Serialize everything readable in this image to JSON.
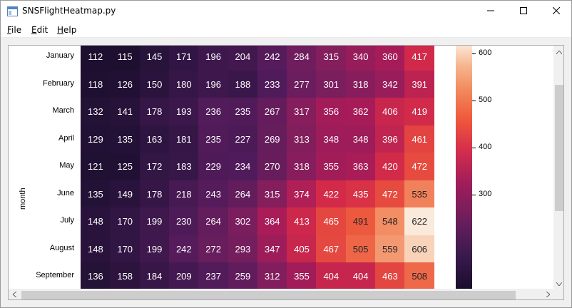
{
  "window": {
    "title": "SNSFlightHeatmap.py",
    "minimize_icon": "minimize-icon",
    "maximize_icon": "maximize-icon",
    "close_icon": "close-icon"
  },
  "menu": {
    "items": [
      {
        "label": "File",
        "mnemonic": "F",
        "rest": "ile"
      },
      {
        "label": "Edit",
        "mnemonic": "E",
        "rest": "dit"
      },
      {
        "label": "Help",
        "mnemonic": "H",
        "rest": "elp"
      }
    ]
  },
  "chart_data": {
    "type": "heatmap",
    "ylabel": "month",
    "rows": [
      "January",
      "February",
      "March",
      "April",
      "May",
      "June",
      "July",
      "August",
      "September"
    ],
    "values": [
      [
        112,
        115,
        145,
        171,
        196,
        204,
        242,
        284,
        315,
        340,
        360,
        417
      ],
      [
        118,
        126,
        150,
        180,
        196,
        188,
        233,
        277,
        301,
        318,
        342,
        391
      ],
      [
        132,
        141,
        178,
        193,
        236,
        235,
        267,
        317,
        356,
        362,
        406,
        419
      ],
      [
        129,
        135,
        163,
        181,
        235,
        227,
        269,
        313,
        348,
        348,
        396,
        461
      ],
      [
        121,
        125,
        172,
        183,
        229,
        234,
        270,
        318,
        355,
        363,
        420,
        472
      ],
      [
        135,
        149,
        178,
        218,
        243,
        264,
        315,
        374,
        422,
        435,
        472,
        535
      ],
      [
        148,
        170,
        199,
        230,
        264,
        302,
        364,
        413,
        465,
        491,
        548,
        622
      ],
      [
        148,
        170,
        199,
        242,
        272,
        293,
        347,
        405,
        467,
        505,
        559,
        606
      ],
      [
        136,
        158,
        184,
        209,
        237,
        259,
        312,
        355,
        404,
        404,
        463,
        508
      ]
    ],
    "colorbar": {
      "ticks": [
        "600",
        "500",
        "400",
        "300"
      ],
      "tick_values": [
        600,
        500,
        400,
        300
      ],
      "range": [
        104,
        622
      ]
    },
    "colormap": "rocket"
  }
}
